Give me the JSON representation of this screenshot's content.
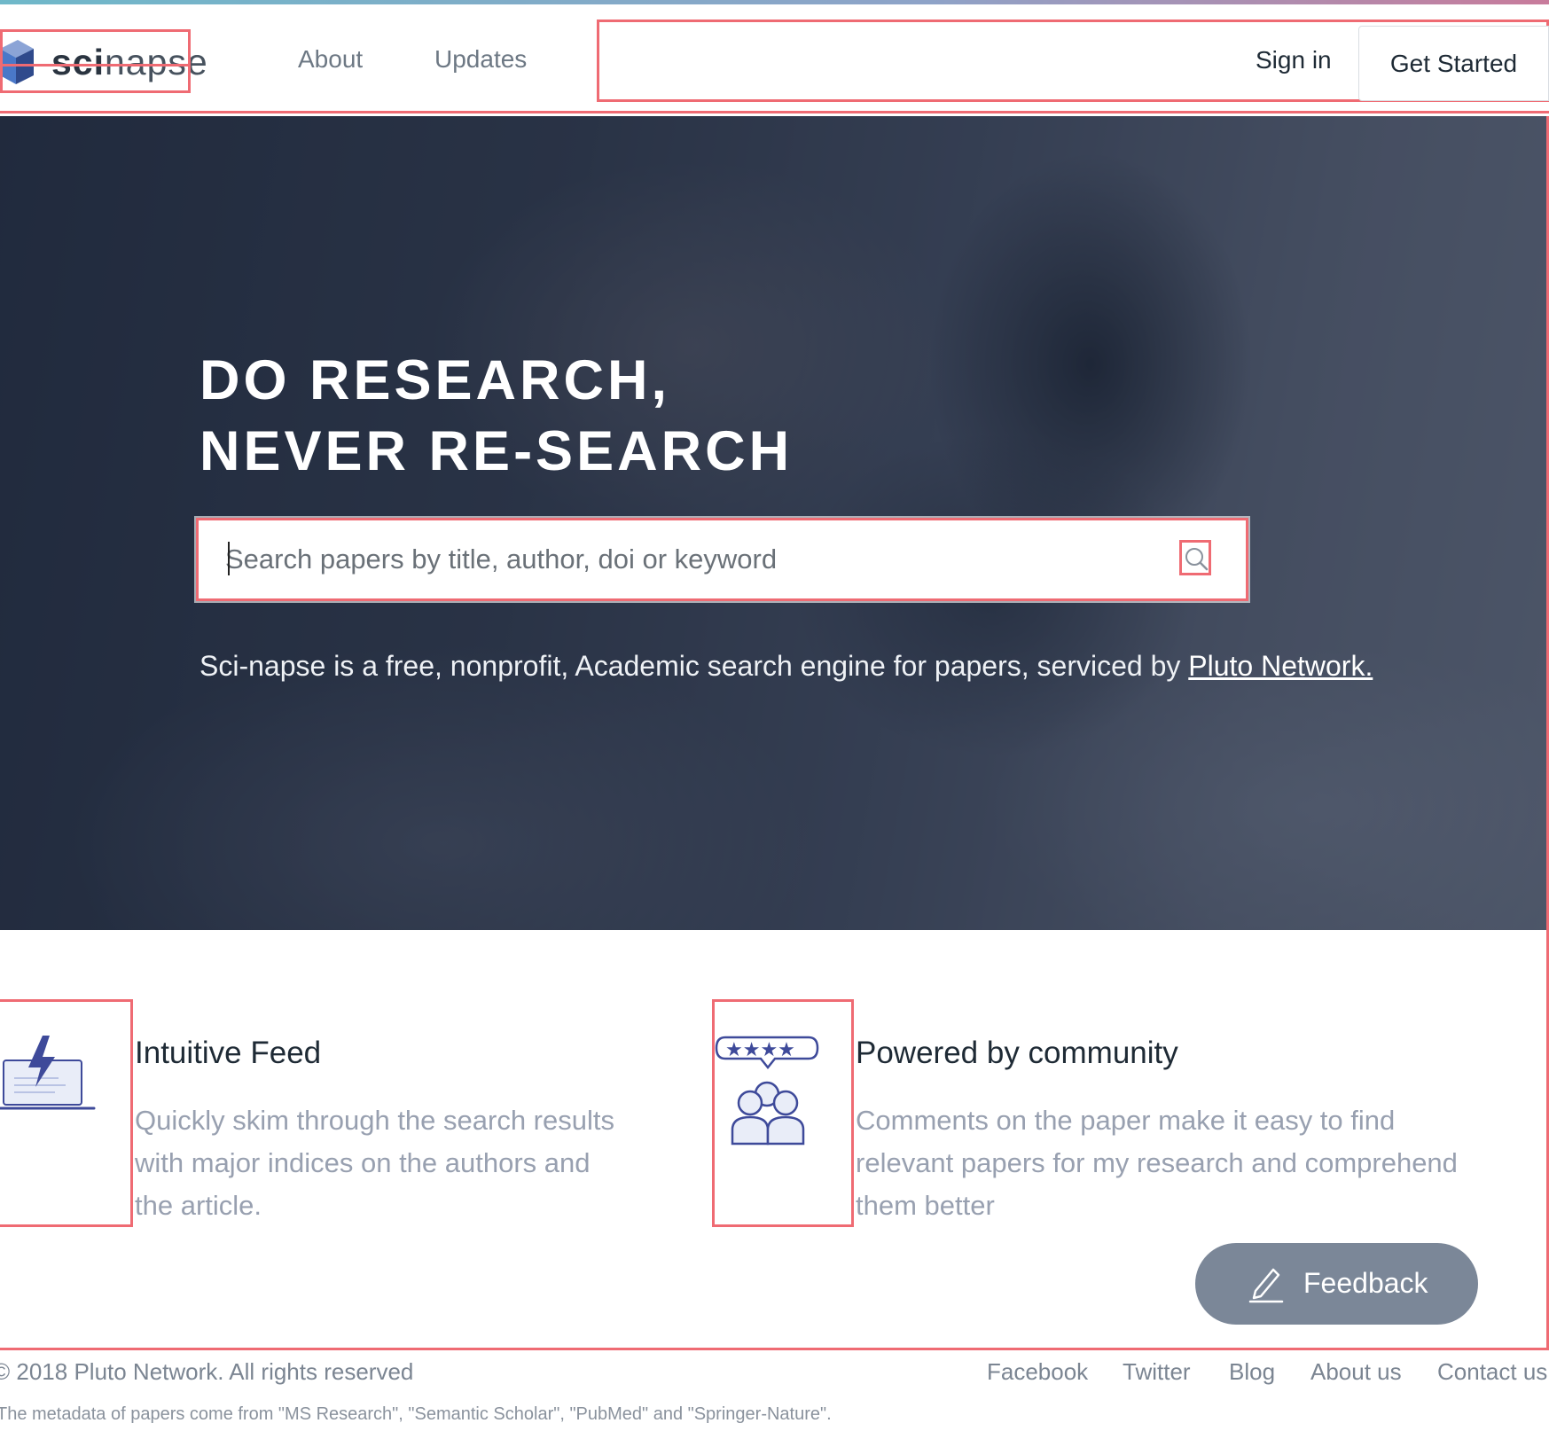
{
  "header": {
    "logo_bold": "sci",
    "logo_light": "napse",
    "nav": [
      {
        "label": "About"
      },
      {
        "label": "Updates"
      }
    ],
    "sign_in": "Sign in",
    "get_started": "Get Started"
  },
  "hero": {
    "title_line1": "DO RESEARCH,",
    "title_line2": "NEVER RE-SEARCH",
    "search_placeholder": "Search papers by title, author, doi or keyword",
    "search_value": "",
    "description": "Sci-napse is a free, nonprofit, Academic search engine for papers, serviced by ",
    "description_link": "Pluto Network."
  },
  "features": [
    {
      "icon": "laptop-lightning-icon",
      "title": "Intuitive Feed",
      "description": "Quickly skim through the search results with major indices on the authors and the article."
    },
    {
      "icon": "community-rating-icon",
      "title": "Powered by community",
      "description": "Comments on the paper make it easy to find relevant papers for my research and comprehend them better"
    }
  ],
  "feedback": {
    "label": "Feedback",
    "icon": "pencil-icon"
  },
  "footer": {
    "copyright": "© 2018 Pluto Network. All rights reserved",
    "links": [
      {
        "label": "Facebook"
      },
      {
        "label": "Twitter"
      },
      {
        "label": "Blog"
      },
      {
        "label": "About us"
      },
      {
        "label": "Contact us"
      }
    ],
    "metadata_note": "The metadata of papers come from \"MS Research\", \"Semantic Scholar\", \"PubMed\" and \"Springer-Nature\"."
  },
  "colors": {
    "brand_dark": "#1e2a35",
    "accent_icon": "#3e4a9a",
    "feedback_bg": "#7b8798",
    "annotation_red": "#ef6b73"
  }
}
